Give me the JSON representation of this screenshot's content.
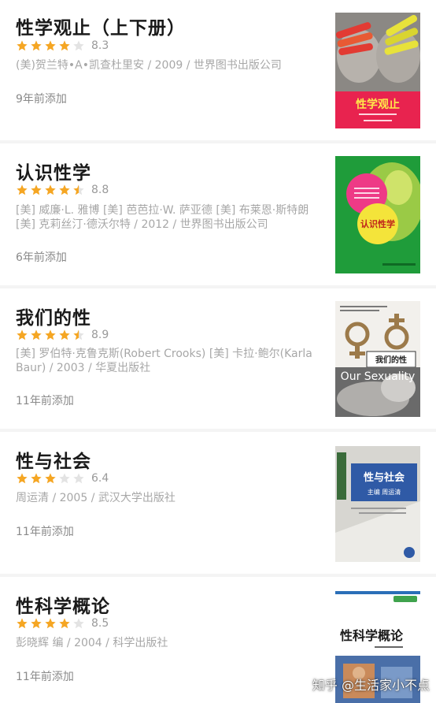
{
  "books": [
    {
      "title": "性学观止（上下册）",
      "stars": [
        1,
        1,
        1,
        1,
        0
      ],
      "score": "8.3",
      "meta": "(美)贺兰特•A•凯查杜里安 / 2009 / 世界图书出版公司",
      "added": "9年前添加",
      "cover_text": "性学观止"
    },
    {
      "title": "认识性学",
      "stars": [
        1,
        1,
        1,
        1,
        0.5
      ],
      "score": "8.8",
      "meta": "[美] 威廉·L. 雅博 [美] 芭芭拉·W. 萨亚德 [美] 布莱恩·斯特朗 [美] 克莉丝汀·德沃尔特 / 2012 / 世界图书出版公司",
      "added": "6年前添加",
      "cover_text": "认识性学"
    },
    {
      "title": "我们的性",
      "stars": [
        1,
        1,
        1,
        1,
        0.5
      ],
      "score": "8.9",
      "meta": "[美] 罗伯特·克鲁克斯(Robert Crooks) [美] 卡拉·鲍尔(Karla Baur) / 2003 / 华夏出版社",
      "added": "11年前添加",
      "cover_text": "我们的性",
      "cover_subtext": "Our Sexuality"
    },
    {
      "title": "性与社会",
      "stars": [
        1,
        1,
        1,
        0,
        0
      ],
      "score": "6.4",
      "meta": "周运清 / 2005 / 武汉大学出版社",
      "added": "11年前添加",
      "cover_text": "性与社会",
      "cover_subtext": "主编 周运清"
    },
    {
      "title": "性科学概论",
      "stars": [
        1,
        1,
        1,
        1,
        0
      ],
      "score": "8.5",
      "meta": "彭晓辉 编 / 2004 / 科学出版社",
      "added": "11年前添加",
      "cover_text": "性科学概论"
    }
  ],
  "watermark": "知乎 @生活家小不点",
  "colors": {
    "star_on": "#f5a623",
    "star_off": "#e3e3e3"
  }
}
